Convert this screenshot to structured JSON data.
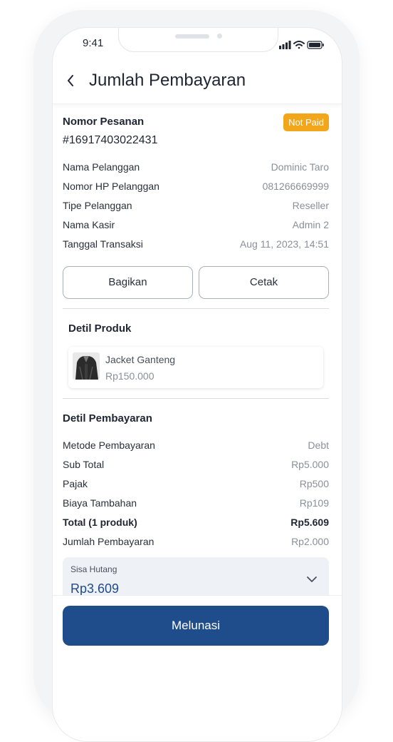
{
  "status_bar": {
    "time": "9:41"
  },
  "header": {
    "title": "Jumlah Pembayaran"
  },
  "order": {
    "label": "Nomor Pesanan",
    "number": "#16917403022431",
    "status_badge": "Not Paid",
    "details": [
      {
        "label": "Nama Pelanggan",
        "value": "Dominic Taro"
      },
      {
        "label": "Nomor HP Pelanggan",
        "value": "081266669999"
      },
      {
        "label": "Tipe Pelanggan",
        "value": "Reseller"
      },
      {
        "label": "Nama Kasir",
        "value": "Admin 2"
      },
      {
        "label": "Tanggal Transaksi",
        "value": "Aug 11, 2023, 14:51"
      }
    ]
  },
  "actions": {
    "share_label": "Bagikan",
    "print_label": "Cetak"
  },
  "products": {
    "title": "Detil Produk",
    "items": [
      {
        "name": "Jacket Ganteng",
        "price": "Rp150.000"
      }
    ]
  },
  "payment": {
    "title": "Detil Pembayaran",
    "rows": [
      {
        "label": "Metode Pembayaran",
        "value": "Debt"
      },
      {
        "label": "Sub Total",
        "value": "Rp5.000"
      },
      {
        "label": "Pajak",
        "value": "Rp500"
      },
      {
        "label": "Biaya Tambahan",
        "value": "Rp109"
      },
      {
        "label": "Total (1 produk)",
        "value": "Rp5.609"
      },
      {
        "label": "Jumlah Pembayaran",
        "value": "Rp2.000"
      }
    ],
    "remaining_debt": {
      "label": "Sisa Hutang",
      "value": "Rp3.609"
    }
  },
  "footer": {
    "primary_label": "Melunasi"
  },
  "colors": {
    "primary": "#1f4c8a",
    "badge": "#f2a619",
    "debt_bg": "#eef2f7"
  }
}
